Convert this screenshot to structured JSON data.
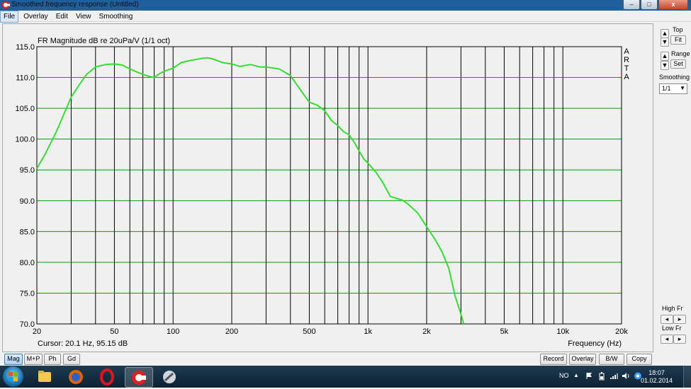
{
  "window": {
    "title": "Smoothed frequency response (Untitled)",
    "buttons": [
      "–",
      "□",
      "x"
    ]
  },
  "menu": [
    "File",
    "Overlay",
    "Edit",
    "View",
    "Smoothing"
  ],
  "chart_data": {
    "type": "line",
    "title": "FR Magnitude dB re 20uPa/V (1/1 oct)",
    "xlabel": "Frequency (Hz)",
    "ylabel": "",
    "xscale": "log",
    "xlim": [
      20,
      20000
    ],
    "ylim": [
      70,
      115
    ],
    "x_tick_labels": [
      {
        "v": 20,
        "t": "20"
      },
      {
        "v": 50,
        "t": "50"
      },
      {
        "v": 100,
        "t": "100"
      },
      {
        "v": 200,
        "t": "200"
      },
      {
        "v": 500,
        "t": "500"
      },
      {
        "v": 1000,
        "t": "1k"
      },
      {
        "v": 2000,
        "t": "2k"
      },
      {
        "v": 5000,
        "t": "5k"
      },
      {
        "v": 10000,
        "t": "10k"
      },
      {
        "v": 20000,
        "t": "20k"
      }
    ],
    "x_gridlines": [
      30,
      40,
      50,
      60,
      70,
      80,
      90,
      100,
      200,
      300,
      400,
      500,
      600,
      700,
      800,
      900,
      1000,
      2000,
      3000,
      4000,
      5000,
      6000,
      7000,
      8000,
      9000,
      10000
    ],
    "y_ticks": [
      "70.0",
      "75.0",
      "80.0",
      "85.0",
      "90.0",
      "95.0",
      "100.0",
      "105.0",
      "110.0",
      "115.0"
    ],
    "grid": true,
    "watermark": "ARTA",
    "series": [
      {
        "color": "#33dd33",
        "points": [
          [
            20,
            95.2
          ],
          [
            22,
            97.5
          ],
          [
            25,
            101.0
          ],
          [
            28,
            104.6
          ],
          [
            30,
            106.8
          ],
          [
            33,
            108.8
          ],
          [
            36,
            110.5
          ],
          [
            40,
            111.7
          ],
          [
            45,
            112.1
          ],
          [
            50,
            112.2
          ],
          [
            55,
            112.0
          ],
          [
            60,
            111.4
          ],
          [
            65,
            110.9
          ],
          [
            70,
            110.5
          ],
          [
            75,
            110.2
          ],
          [
            80,
            110.0
          ],
          [
            85,
            110.6
          ],
          [
            90,
            111.0
          ],
          [
            100,
            111.5
          ],
          [
            110,
            112.4
          ],
          [
            120,
            112.7
          ],
          [
            130,
            112.9
          ],
          [
            140,
            113.1
          ],
          [
            150,
            113.2
          ],
          [
            160,
            113.0
          ],
          [
            170,
            112.7
          ],
          [
            180,
            112.4
          ],
          [
            200,
            112.2
          ],
          [
            220,
            111.8
          ],
          [
            250,
            112.1
          ],
          [
            280,
            111.7
          ],
          [
            300,
            111.7
          ],
          [
            350,
            111.4
          ],
          [
            400,
            110.3
          ],
          [
            450,
            108.0
          ],
          [
            500,
            106.0
          ],
          [
            550,
            105.5
          ],
          [
            600,
            104.6
          ],
          [
            650,
            103.0
          ],
          [
            700,
            102.2
          ],
          [
            750,
            101.2
          ],
          [
            800,
            100.7
          ],
          [
            850,
            99.5
          ],
          [
            900,
            98.1
          ],
          [
            950,
            96.8
          ],
          [
            1000,
            96.1
          ],
          [
            1100,
            94.6
          ],
          [
            1200,
            92.8
          ],
          [
            1300,
            90.7
          ],
          [
            1400,
            90.4
          ],
          [
            1500,
            90.1
          ],
          [
            1600,
            89.5
          ],
          [
            1800,
            88.0
          ],
          [
            2000,
            85.8
          ],
          [
            2200,
            83.8
          ],
          [
            2400,
            81.7
          ],
          [
            2600,
            79.0
          ],
          [
            2800,
            74.5
          ],
          [
            3000,
            71.6
          ],
          [
            3100,
            70.0
          ]
        ]
      }
    ]
  },
  "cursor_readout": "Cursor: 20.1 Hz, 95.15 dB",
  "side_panel": {
    "top_label": "Top",
    "fit_label": "Fit",
    "range_label": "Range",
    "set_label": "Set",
    "smoothing_label": "Smoothing",
    "smoothing_value": "1/1",
    "high_fr_label": "High Fr",
    "low_fr_label": "Low Fr"
  },
  "bottom_buttons_left": [
    "Mag",
    "M+P",
    "Ph",
    "Gd"
  ],
  "bottom_buttons_right": [
    "Record",
    "Overlay",
    "B/W",
    "Copy"
  ],
  "taskbar": {
    "language": "NO",
    "time": "18:07",
    "date": "01.02.2014"
  }
}
